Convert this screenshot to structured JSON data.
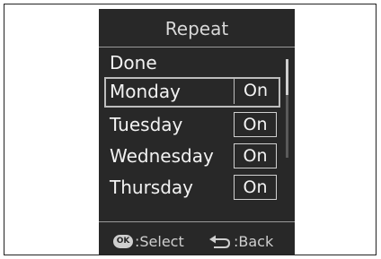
{
  "screen": {
    "title": "Repeat",
    "done_label": "Done",
    "days": [
      {
        "label": "Monday",
        "value": "On",
        "selected": true
      },
      {
        "label": "Tuesday",
        "value": "On",
        "selected": false
      },
      {
        "label": "Wednesday",
        "value": "On",
        "selected": false
      },
      {
        "label": "Thursday",
        "value": "On",
        "selected": false
      }
    ]
  },
  "footer": {
    "ok_icon_text": "OK",
    "select_label": ":Select",
    "back_label": ":Back"
  },
  "icons": {
    "ok": "ok-button-icon",
    "back": "back-arrow-icon"
  },
  "colors": {
    "screen_bg": "#282828",
    "text": "#f2f2f2",
    "highlight_border": "#bdbdbd"
  }
}
